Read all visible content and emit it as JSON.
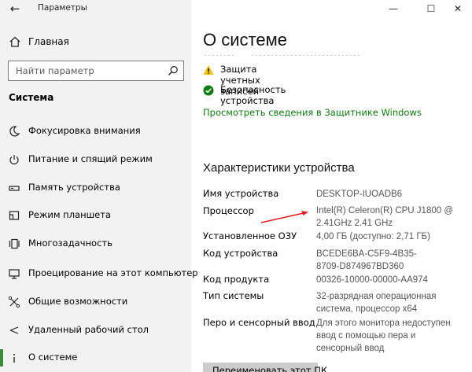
{
  "window": {
    "title": "Параметры"
  },
  "sidebar": {
    "home": "Главная",
    "search_placeholder": "Найти параметр",
    "section": "Система",
    "items": [
      {
        "label": "Фокусировка внимания",
        "icon": "moon-icon"
      },
      {
        "label": "Питание и спящий режим",
        "icon": "power-icon"
      },
      {
        "label": "Память устройства",
        "icon": "storage-icon"
      },
      {
        "label": "Режим планшета",
        "icon": "tablet-icon"
      },
      {
        "label": "Многозадачность",
        "icon": "multitask-icon"
      },
      {
        "label": "Проецирование на этот компьютер",
        "icon": "projector-icon"
      },
      {
        "label": "Общие возможности",
        "icon": "shared-icon"
      },
      {
        "label": "Удаленный рабочий стол",
        "icon": "remote-desktop-icon"
      },
      {
        "label": "О системе",
        "icon": "info-icon",
        "active": true
      }
    ]
  },
  "main": {
    "title": "О системе",
    "status": [
      {
        "label": "Защита учетных записей",
        "icon": "warning-icon"
      },
      {
        "label": "Безопасность устройства",
        "icon": "check-icon"
      }
    ],
    "defender_link": "Просмотреть сведения в Защитнике Windows",
    "specs_title": "Характеристики устройства",
    "specs": [
      {
        "label": "Имя устройства",
        "value": "DESKTOP-IUOADB6"
      },
      {
        "label": "Процессор",
        "value": "Intel(R) Celeron(R) CPU  J1800  @ 2.41GHz   2.41 GHz"
      },
      {
        "label": "Установленное ОЗУ",
        "value": "4,00 ГБ (доступно: 2,71 ГБ)"
      },
      {
        "label": "Код устройства",
        "value": "BCEDE6BA-C5F9-4B35-8709-D874967BD360"
      },
      {
        "label": "Код продукта",
        "value": "00326-10000-00000-AA974"
      },
      {
        "label": "Тип системы",
        "value": "32-разрядная операционная система, процессор x64"
      },
      {
        "label": "Перо и сенсорный ввод",
        "value": "Для этого монитора недоступен ввод с помощью пера и сенсорный ввод"
      }
    ],
    "rename_button": "Переименовать этот ПК"
  },
  "colors": {
    "accent": "#107c10",
    "active_bar": "#3a8a3a",
    "warning": "#f2c000"
  }
}
